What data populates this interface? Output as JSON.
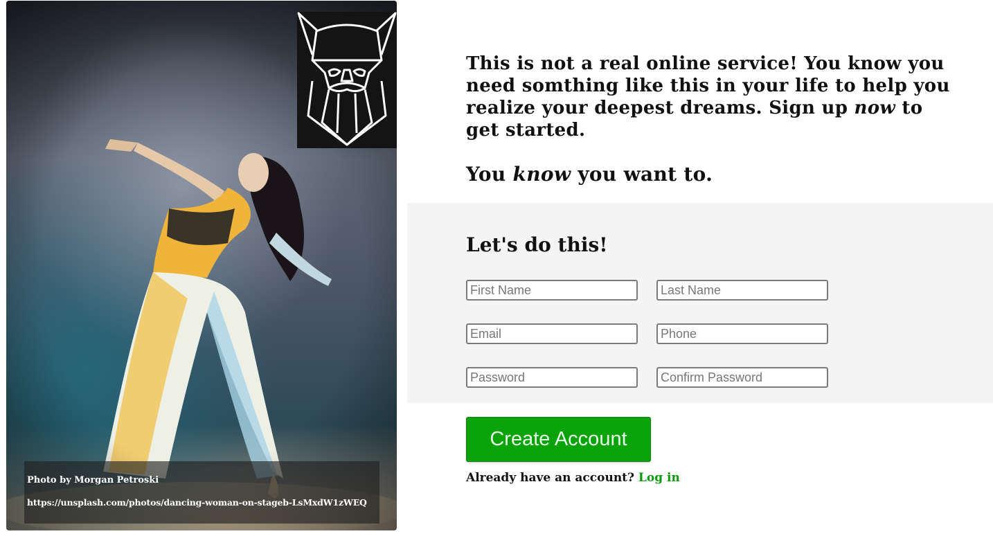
{
  "photo": {
    "alt": "dancer",
    "credit_by": "Photo by Morgan Petroski",
    "credit_url": "https://unsplash.com/photos/dancing-woman-on-stageb-LsMxdW1zWEQ"
  },
  "logo": {
    "icon": "viking-head-logo"
  },
  "intro": {
    "line_a": "This is not a real online service! You know you need somthing like this in your life to help you realize your deepest dreams. Sign up ",
    "line_em": "now",
    "line_b": " to get started.",
    "tag_a": "You ",
    "tag_em": "know",
    "tag_b": " you want to."
  },
  "form": {
    "title": "Let's do this!",
    "first_name_placeholder": "First Name",
    "last_name_placeholder": "Last Name",
    "email_placeholder": "Email",
    "phone_placeholder": "Phone",
    "password_placeholder": "Password",
    "confirm_password_placeholder": "Confirm Password"
  },
  "actions": {
    "create_label": "Create Account",
    "already_text": "Already have an account? ",
    "login_label": "Log in"
  },
  "colors": {
    "accent": "#0aa30a",
    "link": "#0b9a0b",
    "panel_bg": "#f4f4f4"
  }
}
